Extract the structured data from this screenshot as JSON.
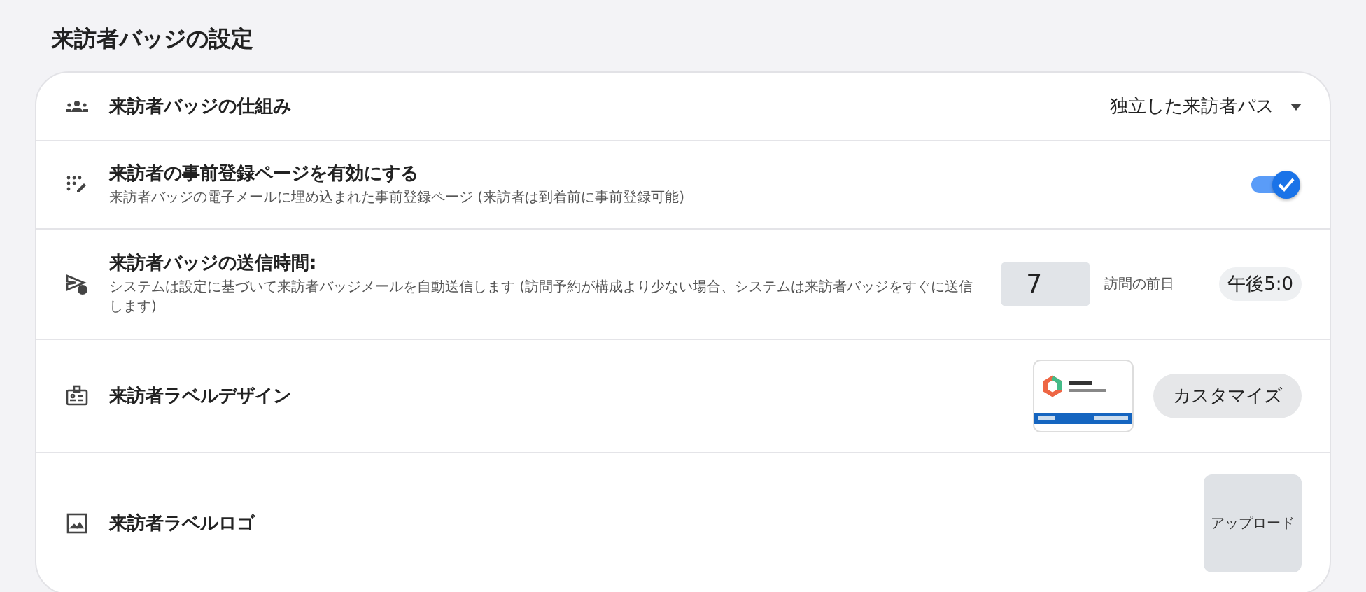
{
  "title": "来訪者バッジの設定",
  "rows": [
    {
      "kind": "select",
      "label": "来訪者バッジの仕組み",
      "value": "独立した来訪者パス"
    },
    {
      "kind": "toggle",
      "label": "来訪者の事前登録ページを有効にする",
      "description": "来訪者バッジの電子メールに埋め込まれた事前登録ページ (来訪者は到着前に事前登録可能)",
      "on": true
    },
    {
      "kind": "schedule",
      "label": "来訪者バッジの送信時間:",
      "description": "システムは設定に基づいて来訪者バッジメールを自動送信します (訪問予約が構成より少ない場合、システムは来訪者バッジをすぐに送信します)",
      "days": "7",
      "unit": "訪問の前日",
      "time": "午後5:0"
    },
    {
      "kind": "design",
      "label": "来訪者ラベルデザイン",
      "button": "カスタマイズ"
    },
    {
      "kind": "upload",
      "label": "来訪者ラベルロゴ",
      "button": "アップロード"
    }
  ]
}
